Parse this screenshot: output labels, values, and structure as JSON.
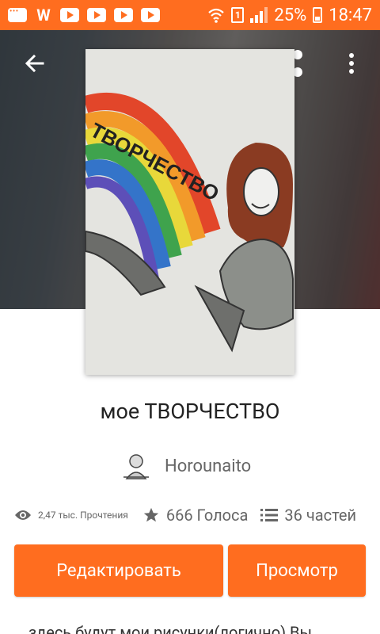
{
  "status_bar": {
    "battery": "25%",
    "time": "18:47",
    "sim_label": "1",
    "app_icons": [
      "chat-icon",
      "wattpad-icon",
      "youtube-icon",
      "youtube-icon",
      "youtube-icon",
      "youtube-icon"
    ]
  },
  "toolbar": {
    "back_icon": "arrow-left-icon",
    "share_icon": "share-icon",
    "more_icon": "more-vertical-icon"
  },
  "cover": {
    "text": "ТВОРЧЕСТВО"
  },
  "story": {
    "title": "мое ТВОРЧЕСТВО",
    "author": "Horounaito",
    "reads": "2,47 тыс. Прочтения",
    "votes": "666 Голоса",
    "parts": "36 частей",
    "description": "здесь будут мои рисунки(логично) Вы"
  },
  "buttons": {
    "edit": "Редактировать",
    "view": "Просмотр"
  },
  "colors": {
    "accent": "#ff6d1f",
    "text_primary": "#222222",
    "text_secondary": "#666666"
  }
}
